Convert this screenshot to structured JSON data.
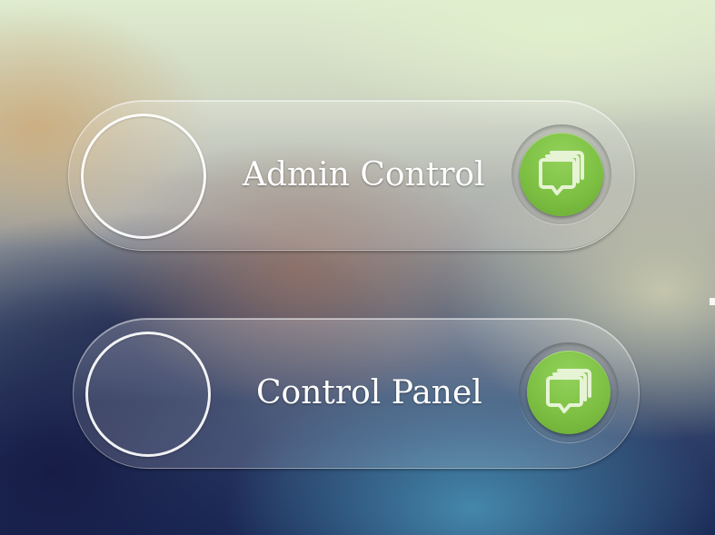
{
  "buttons": [
    {
      "label": "Admin Control",
      "icon": "chat-windows-icon"
    },
    {
      "label": "Control Panel",
      "icon": "chat-windows-icon"
    }
  ],
  "colors": {
    "accent_green": "#7dc043",
    "label_text": "#ffffff",
    "ring_stroke": "#ffffff"
  }
}
